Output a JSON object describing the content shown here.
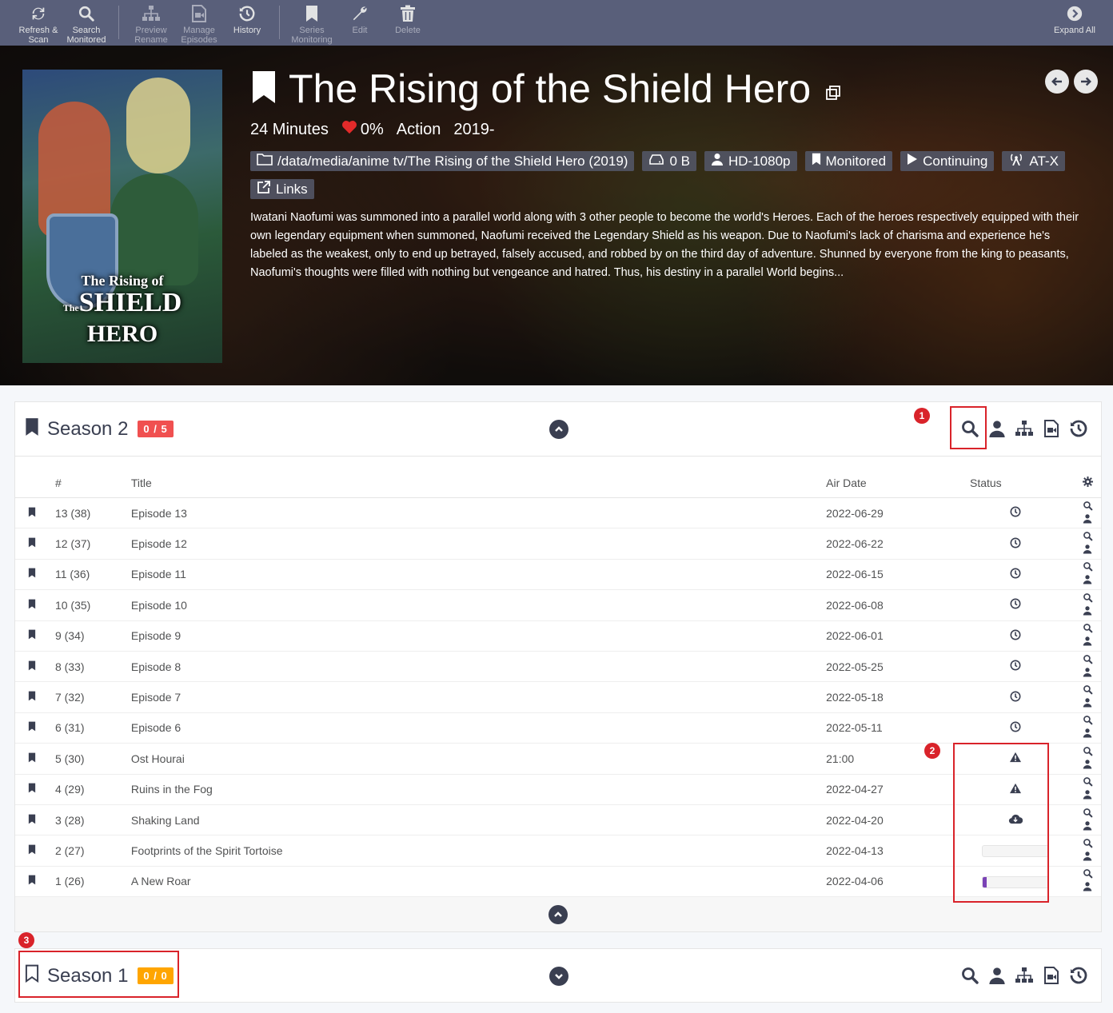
{
  "toolbar": {
    "buttons": [
      {
        "label": "Refresh &\nScan",
        "icon": "refresh-icon"
      },
      {
        "label": "Search\nMonitored",
        "icon": "search-icon"
      },
      {
        "label": "Preview\nRename",
        "icon": "sitemap-icon"
      },
      {
        "label": "Manage\nEpisodes",
        "icon": "file-video-icon"
      },
      {
        "label": "History",
        "icon": "history-icon"
      },
      {
        "label": "Series\nMonitoring",
        "icon": "bookmark-icon"
      },
      {
        "label": "Edit",
        "icon": "wrench-icon"
      },
      {
        "label": "Delete",
        "icon": "trash-icon"
      },
      {
        "label": "Expand All",
        "icon": "chevron-circle-right-icon"
      }
    ]
  },
  "series": {
    "title": "The Rising of the Shield Hero",
    "poster": {
      "line1": "The Rising of",
      "line2": "SHIELD",
      "line2_prefix": "The",
      "line3": "HERO"
    },
    "runtime": "24 Minutes",
    "rating": "0%",
    "genre": "Action",
    "years": "2019-",
    "labels": {
      "path": "/data/media/anime tv/The Rising of the Shield Hero (2019)",
      "size": "0 B",
      "quality": "HD-1080p",
      "monitored": "Monitored",
      "status": "Continuing",
      "network": "AT-X",
      "links": "Links"
    },
    "overview": "Iwatani Naofumi was summoned into a parallel world along with 3 other people to become the world's Heroes. Each of the heroes respectively equipped with their own legendary equipment when summoned, Naofumi received the Legendary Shield as his weapon. Due to Naofumi's lack of charisma and experience he's labeled as the weakest, only to end up betrayed, falsely accused, and robbed by on the third day of adventure. Shunned by everyone from the king to peasants, Naofumi's thoughts were filled with nothing but vengeance and hatred. Thus, his destiny in a parallel World begins..."
  },
  "season2": {
    "title": "Season 2",
    "badge": "0 / 5",
    "columns": {
      "num": "#",
      "title": "Title",
      "air": "Air Date",
      "status": "Status"
    },
    "episodes": [
      {
        "num": "13 (38)",
        "title": "Episode 13",
        "air": "2022-06-29",
        "status": "clock-icon"
      },
      {
        "num": "12 (37)",
        "title": "Episode 12",
        "air": "2022-06-22",
        "status": "clock-icon"
      },
      {
        "num": "11 (36)",
        "title": "Episode 11",
        "air": "2022-06-15",
        "status": "clock-icon"
      },
      {
        "num": "10 (35)",
        "title": "Episode 10",
        "air": "2022-06-08",
        "status": "clock-icon"
      },
      {
        "num": "9 (34)",
        "title": "Episode 9",
        "air": "2022-06-01",
        "status": "clock-icon"
      },
      {
        "num": "8 (33)",
        "title": "Episode 8",
        "air": "2022-05-25",
        "status": "clock-icon"
      },
      {
        "num": "7 (32)",
        "title": "Episode 7",
        "air": "2022-05-18",
        "status": "clock-icon"
      },
      {
        "num": "6 (31)",
        "title": "Episode 6",
        "air": "2022-05-11",
        "status": "clock-icon"
      },
      {
        "num": "5 (30)",
        "title": "Ost Hourai",
        "air": "21:00",
        "status": "warning-icon"
      },
      {
        "num": "4 (29)",
        "title": "Ruins in the Fog",
        "air": "2022-04-27",
        "status": "warning-icon"
      },
      {
        "num": "3 (28)",
        "title": "Shaking Land",
        "air": "2022-04-20",
        "status": "cloud-download-icon"
      },
      {
        "num": "2 (27)",
        "title": "Footprints of the Spirit Tortoise",
        "air": "2022-04-13",
        "status": "progress",
        "progress": 0
      },
      {
        "num": "1 (26)",
        "title": "A New Roar",
        "air": "2022-04-06",
        "status": "progress",
        "progress": 0.05
      }
    ]
  },
  "season1": {
    "title": "Season 1",
    "badge": "0 / 0"
  },
  "annotations": [
    "1",
    "2",
    "3"
  ],
  "colors": {
    "toolbar": "#595f7a",
    "badge_red": "#f05050",
    "badge_orange": "#ffa500",
    "annotation": "#d9232a",
    "progress": "#7a43b6"
  }
}
